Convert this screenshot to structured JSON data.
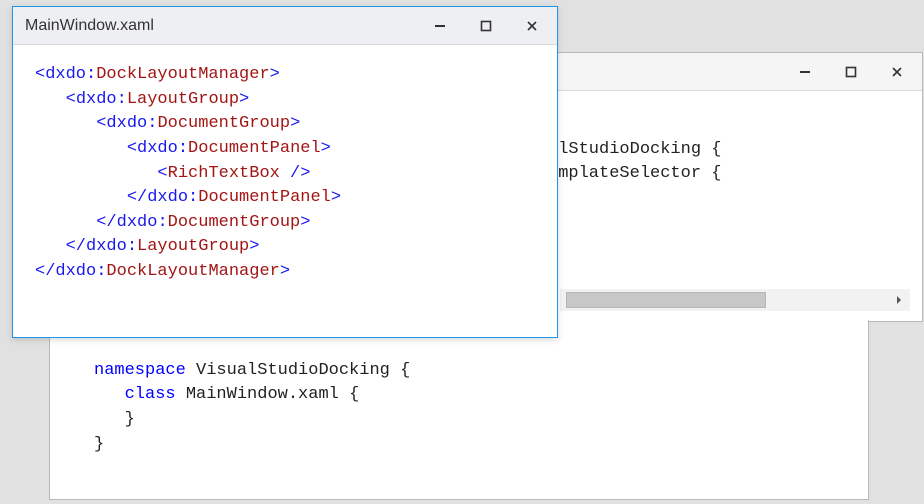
{
  "windows": {
    "front": {
      "title": "MainWindow.xaml",
      "code_lines": [
        {
          "indent": 0,
          "open": true,
          "close": false,
          "selfclose": false,
          "prefix": "dxdo",
          "tag": "DockLayoutManager"
        },
        {
          "indent": 1,
          "open": true,
          "close": false,
          "selfclose": false,
          "prefix": "dxdo",
          "tag": "LayoutGroup"
        },
        {
          "indent": 2,
          "open": true,
          "close": false,
          "selfclose": false,
          "prefix": "dxdo",
          "tag": "DocumentGroup"
        },
        {
          "indent": 3,
          "open": true,
          "close": false,
          "selfclose": false,
          "prefix": "dxdo",
          "tag": "DocumentPanel"
        },
        {
          "indent": 4,
          "open": false,
          "close": false,
          "selfclose": true,
          "prefix": null,
          "tag": "RichTextBox"
        },
        {
          "indent": 3,
          "open": false,
          "close": true,
          "selfclose": false,
          "prefix": "dxdo",
          "tag": "DocumentPanel"
        },
        {
          "indent": 2,
          "open": false,
          "close": true,
          "selfclose": false,
          "prefix": "dxdo",
          "tag": "DocumentGroup"
        },
        {
          "indent": 1,
          "open": false,
          "close": true,
          "selfclose": false,
          "prefix": "dxdo",
          "tag": "LayoutGroup"
        },
        {
          "indent": 0,
          "open": false,
          "close": true,
          "selfclose": false,
          "prefix": "dxdo",
          "tag": "DockLayoutManager"
        }
      ]
    },
    "back_top": {
      "title": "",
      "code_fragments": [
        {
          "kw": "",
          "type": "",
          "plain": "alStudioDocking {"
        },
        {
          "kw": "",
          "type": "",
          "plain": "emplateSelector {"
        }
      ]
    },
    "back_bottom": {
      "code": {
        "kw_namespace": "namespace",
        "ns_name": "VisualStudioDocking",
        "brace_open": "{",
        "kw_class": "class",
        "class_name": "MainWindow.xaml",
        "brace_open2": "{",
        "brace_close2": "}",
        "brace_close": "}"
      }
    }
  },
  "icons": {
    "minimize": "minimize-icon",
    "maximize": "maximize-icon",
    "close": "close-icon"
  }
}
